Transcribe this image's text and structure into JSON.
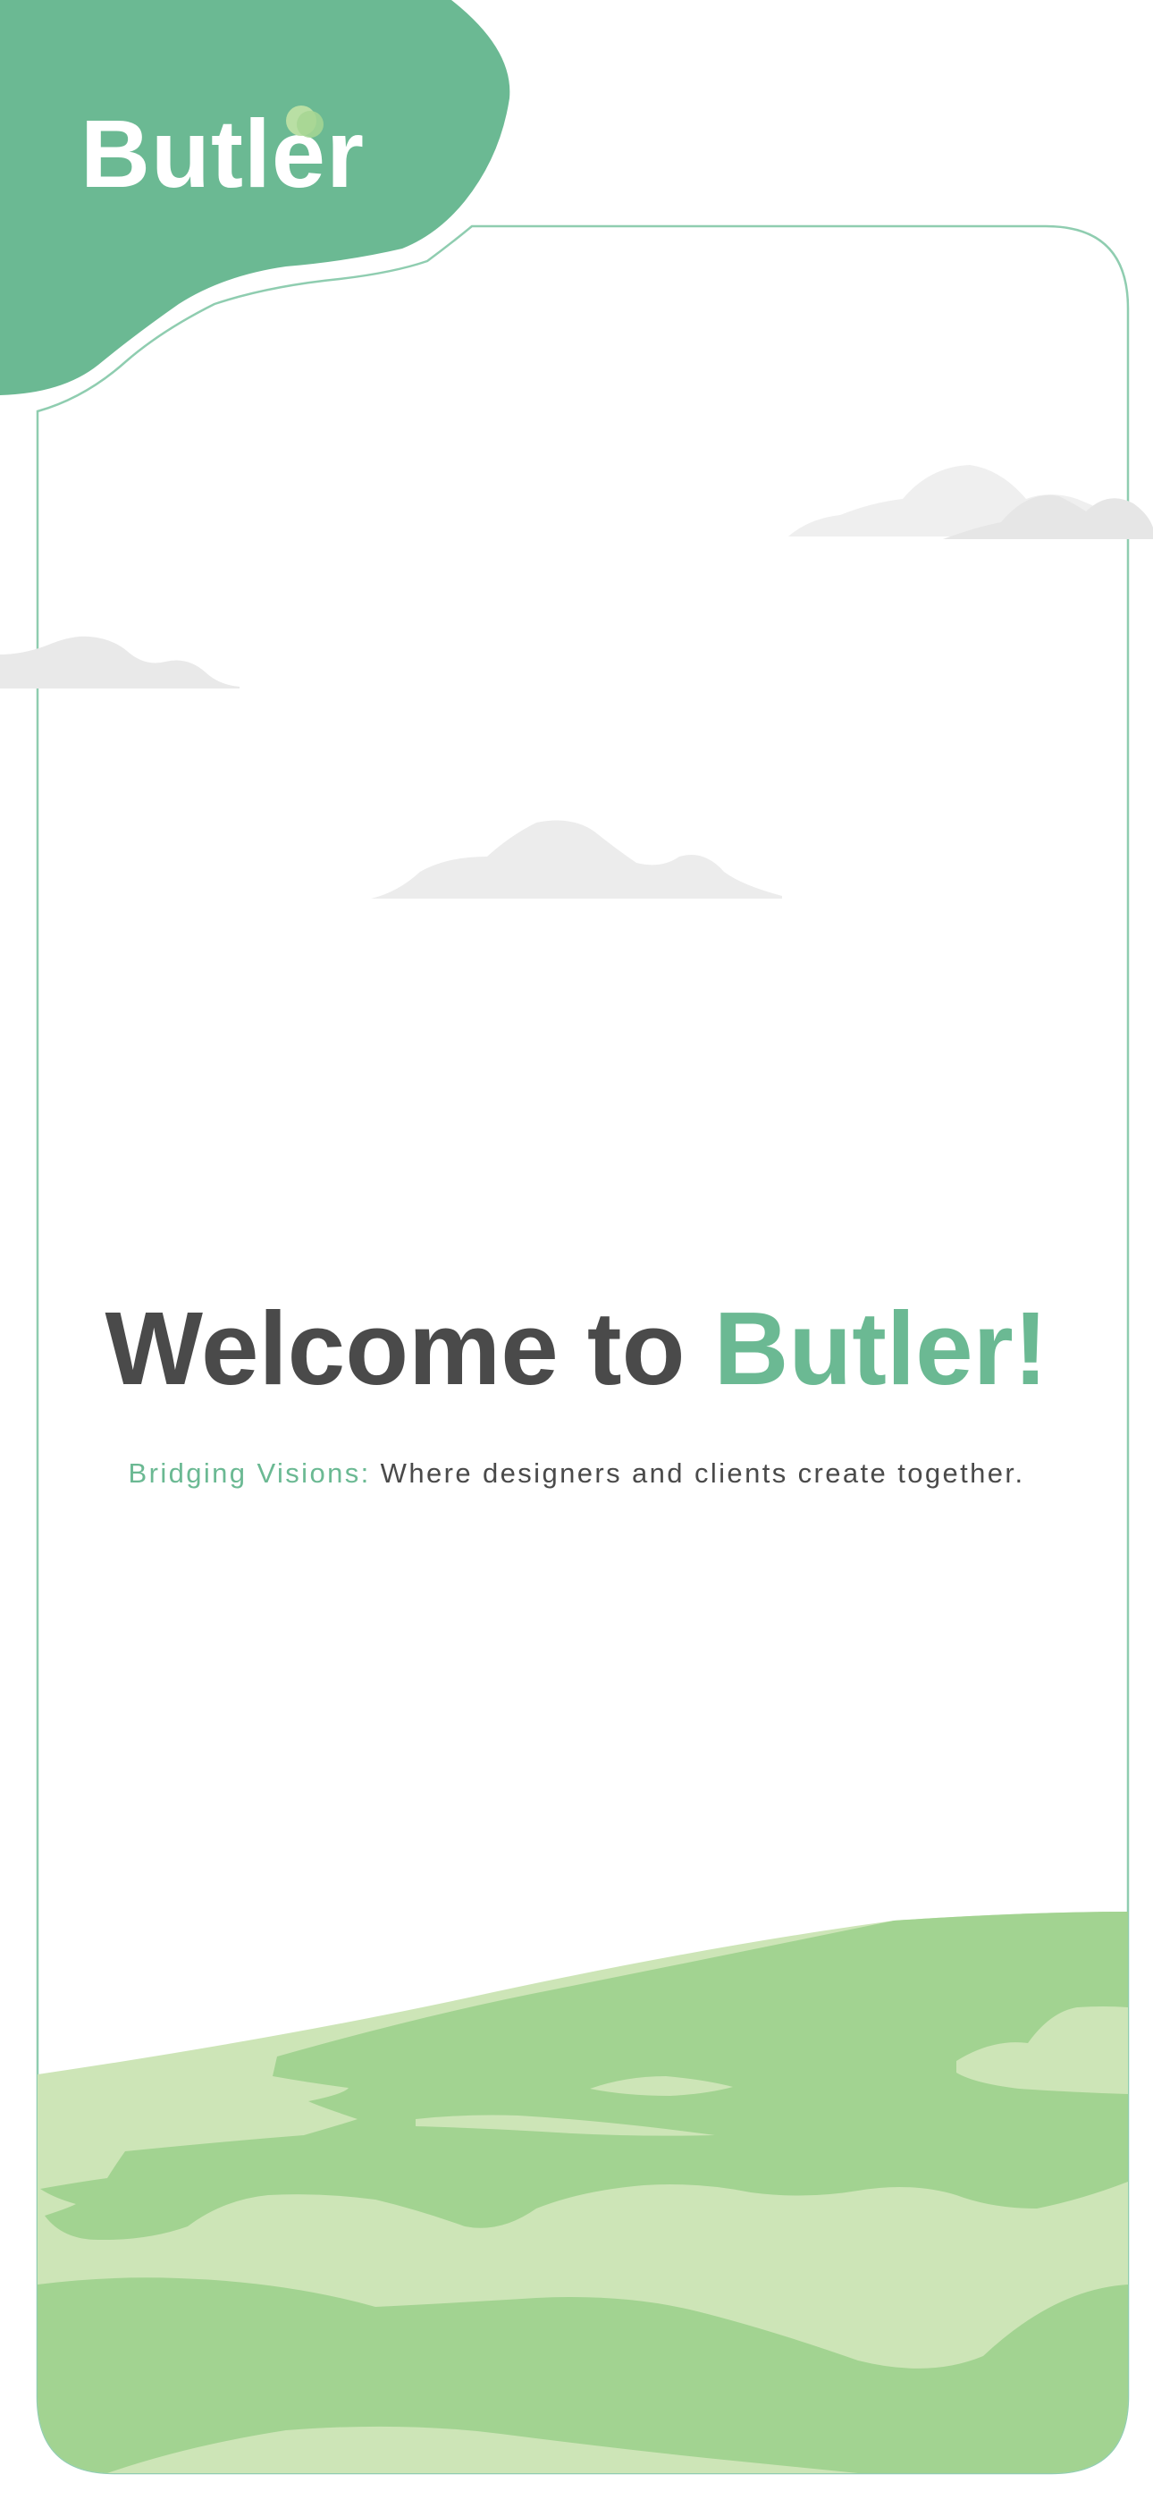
{
  "app": {
    "brand_name": "Butler"
  },
  "welcome": {
    "prefix": "Welcome to ",
    "highlight": "Butler!"
  },
  "tagline": {
    "highlight": "Bridging Visions:",
    "text": " Where designers and clients create together."
  },
  "colors": {
    "brand_green": "#6bb993",
    "meadow_dark": "#a2d391",
    "meadow_light": "#cde5b7",
    "text_dark": "#4a4a4a",
    "cloud": "#ececec"
  }
}
